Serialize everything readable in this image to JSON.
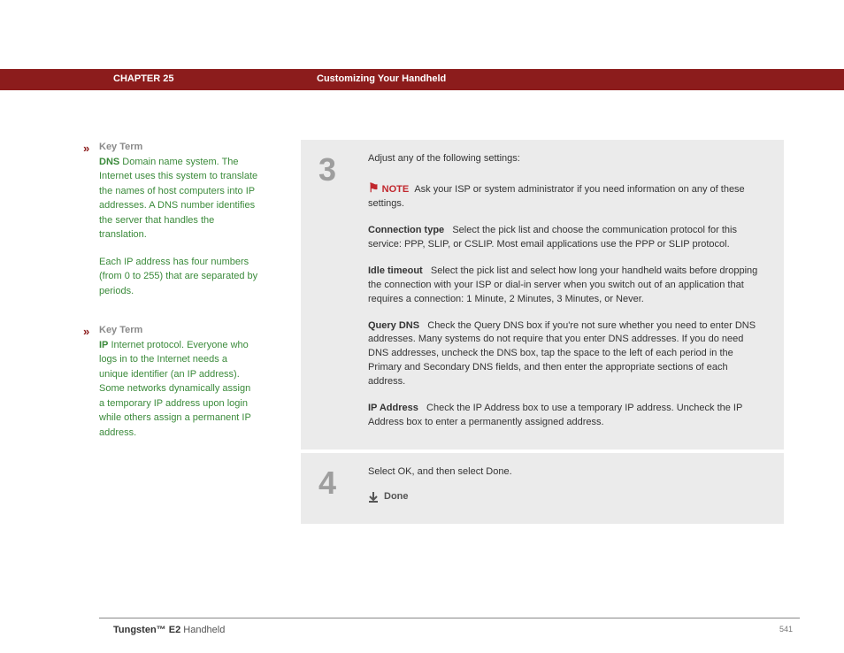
{
  "header": {
    "chapter": "CHAPTER 25",
    "title": "Customizing Your Handheld"
  },
  "sidebar": {
    "keyterms": [
      {
        "label": "Key Term",
        "term": "DNS",
        "def": "Domain name system. The Internet uses this system to translate the names of host computers into IP addresses. A DNS number identifies the server that handles the translation.",
        "extra": "Each IP address has four numbers (from 0 to 255) that are separated by periods."
      },
      {
        "label": "Key Term",
        "term": "IP",
        "def": "Internet protocol. Everyone who logs in to the Internet needs a unique identifier (an IP address). Some networks dynamically assign a temporary IP address upon login while others assign a permanent IP address.",
        "extra": ""
      }
    ]
  },
  "steps": [
    {
      "num": "3",
      "intro": "Adjust any of the following settings:",
      "note_label": "NOTE",
      "note_text": "Ask your ISP or system administrator if you need information on any of these settings.",
      "settings": [
        {
          "name": "Connection type",
          "text": "Select the pick list and choose the communication protocol for this service: PPP, SLIP, or CSLIP. Most email applications use the PPP or SLIP protocol."
        },
        {
          "name": "Idle timeout",
          "text": "Select the pick list and select how long your handheld waits before dropping the connection with your ISP or dial-in server when you switch out of an application that requires a connection: 1 Minute, 2 Minutes, 3 Minutes, or Never."
        },
        {
          "name": "Query DNS",
          "text": "Check the Query DNS box if you're not sure whether you need to enter DNS addresses. Many systems do not require that you enter DNS addresses. If you do need DNS addresses, uncheck the DNS box, tap the space to the left of each period in the Primary and Secondary DNS fields, and then enter the appropriate sections of each address."
        },
        {
          "name": "IP Address",
          "text": "Check the IP Address box to use a temporary IP address. Uncheck the IP Address box to enter a permanently assigned address."
        }
      ]
    },
    {
      "num": "4",
      "intro": "Select OK, and then select Done.",
      "done": "Done"
    }
  ],
  "footer": {
    "product_bold": "Tungsten™ E2",
    "product_rest": " Handheld",
    "page": "541"
  }
}
